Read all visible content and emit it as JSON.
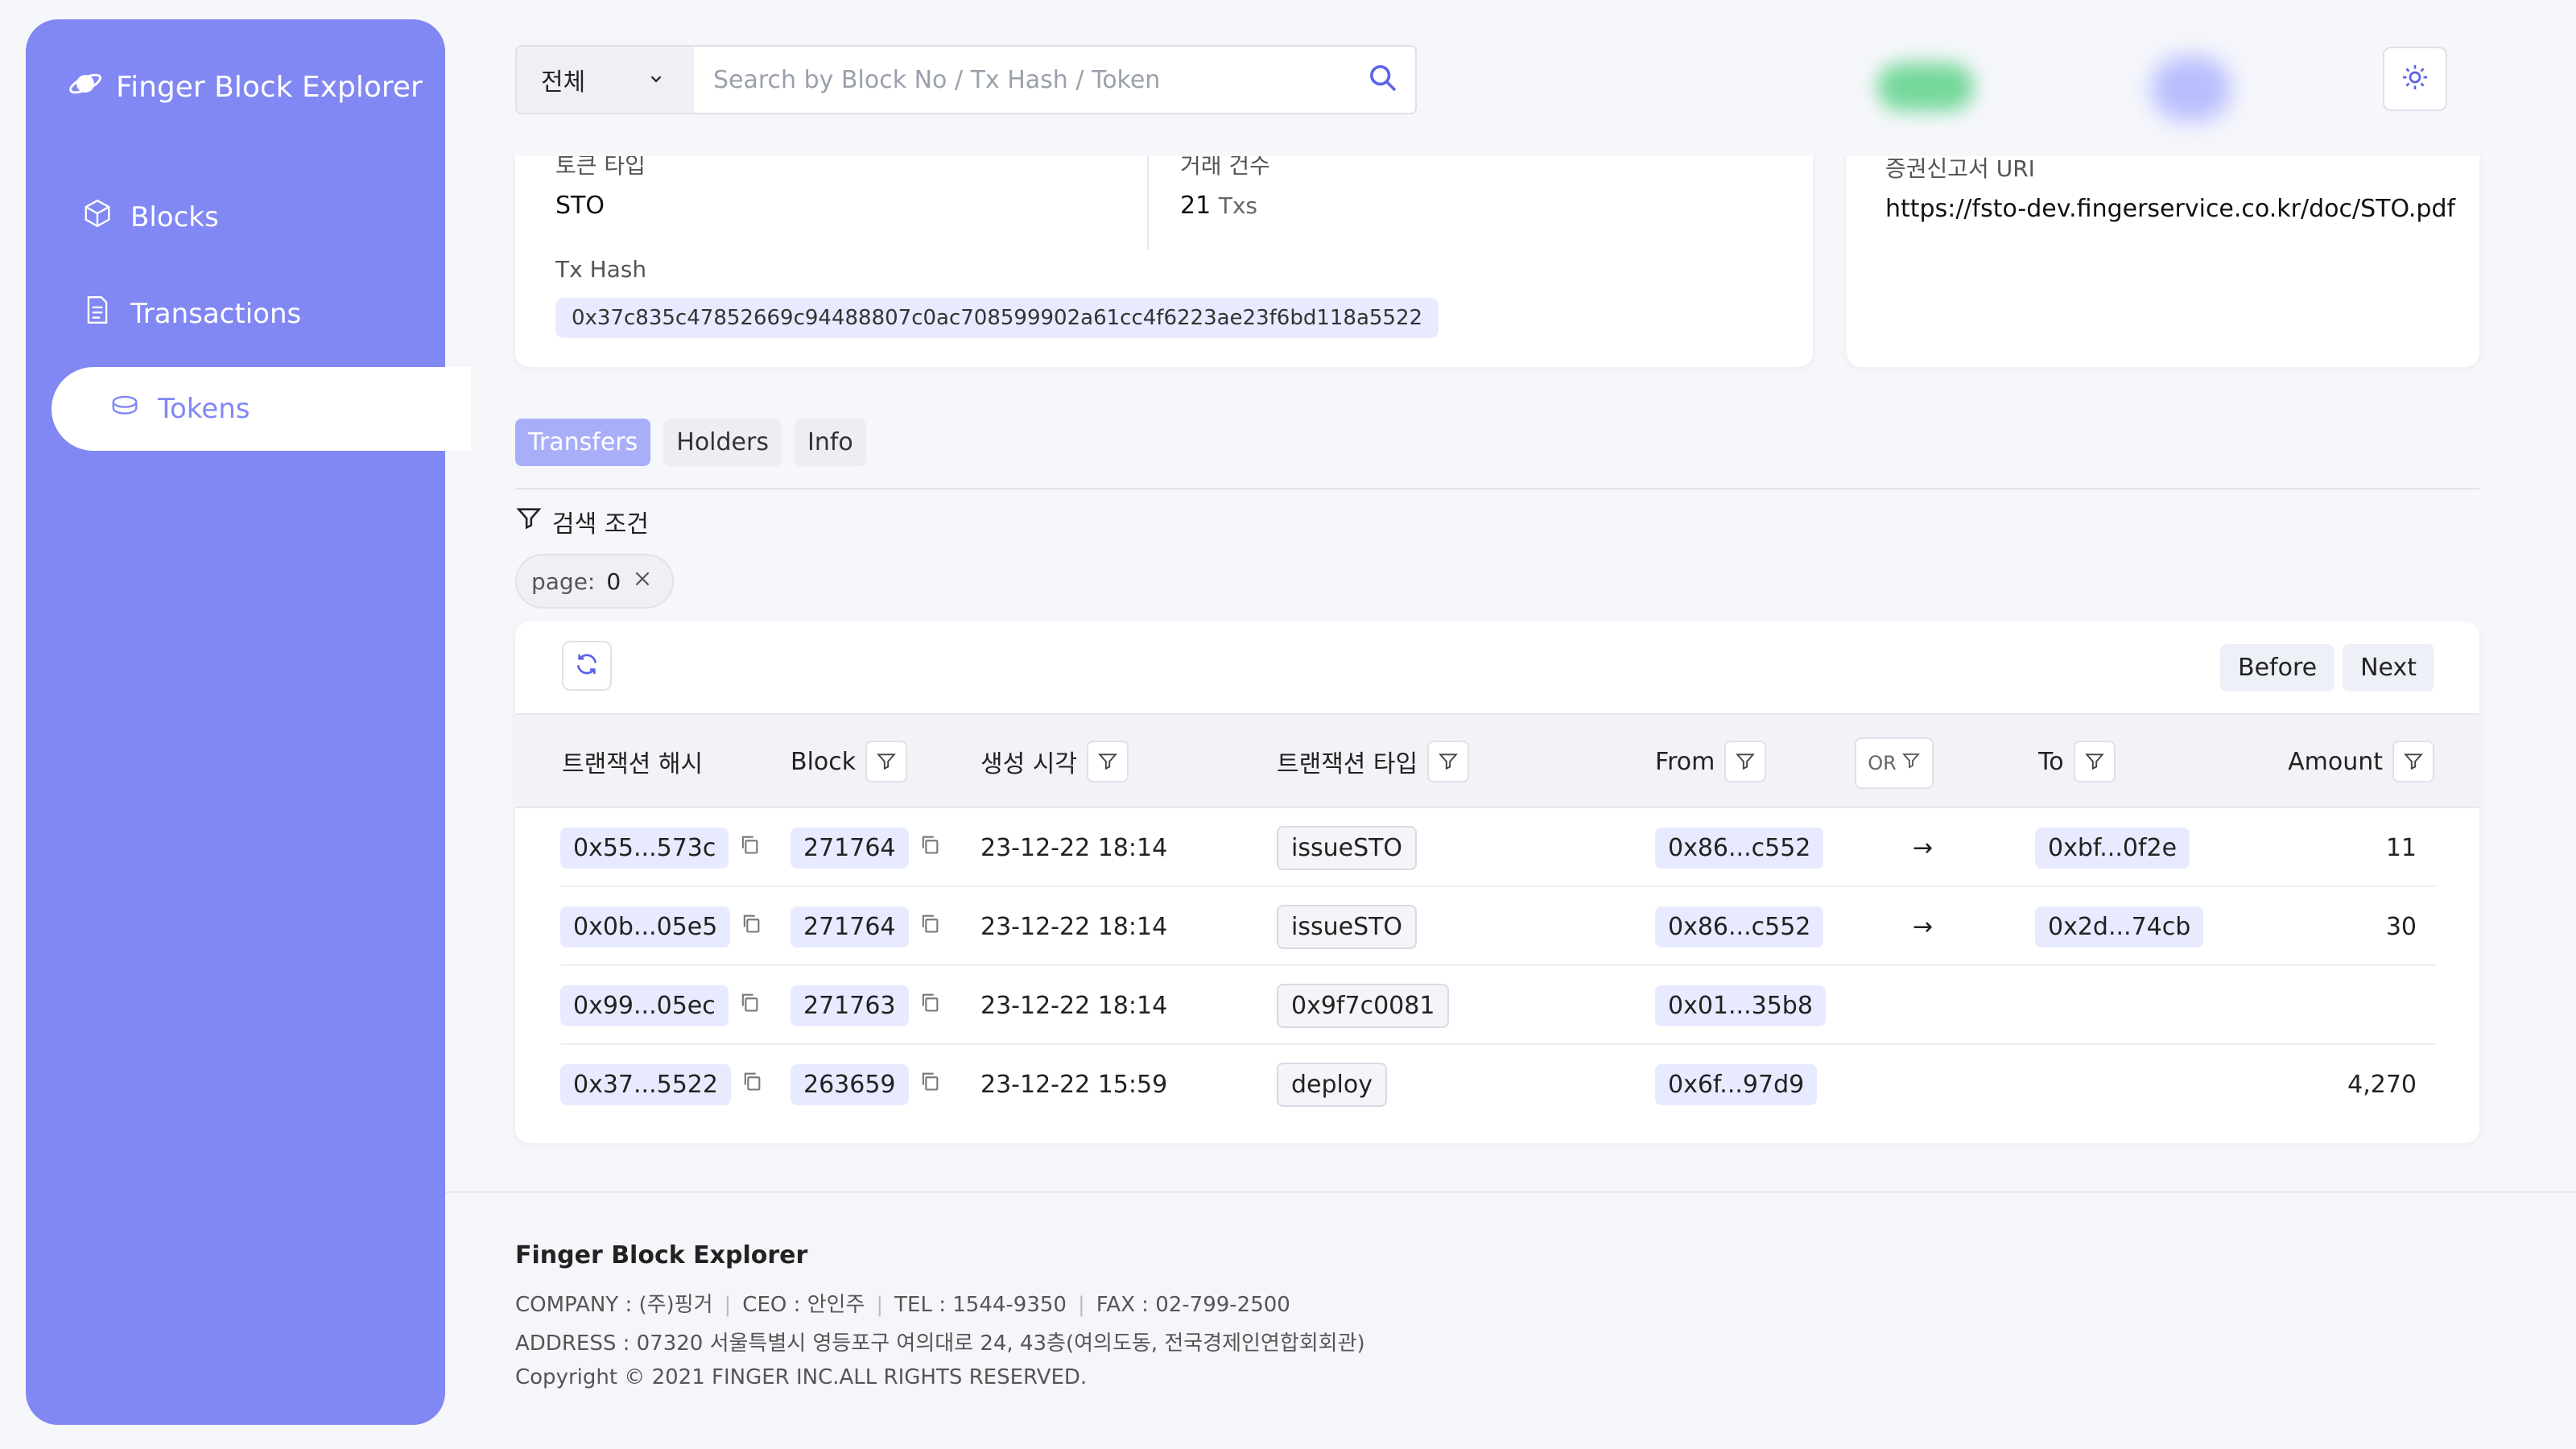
{
  "brand": {
    "name": "Finger Block Explorer"
  },
  "nav": [
    {
      "label": "Blocks",
      "icon": "cube-icon",
      "active": false
    },
    {
      "label": "Transactions",
      "icon": "document-icon",
      "active": false
    },
    {
      "label": "Tokens",
      "icon": "coin-icon",
      "active": true
    }
  ],
  "search": {
    "scope": "전체",
    "placeholder": "Search by Block No / Tx Hash / Token",
    "value": ""
  },
  "token_info": {
    "type_label": "토큰 타입",
    "type_value": "STO",
    "tx_count_label": "거래 건수",
    "tx_count_value": "21",
    "tx_count_unit": "Txs",
    "tx_hash_label": "Tx Hash",
    "tx_hash_value": "0x37c835c47852669c94488807c0ac708599902a61cc4f6223ae23f6bd118a5522",
    "uri_label": "증권신고서 URI",
    "uri_value": "https://fsto-dev.fingerservice.co.kr/doc/STO.pdf"
  },
  "tabs": [
    {
      "label": "Transfers",
      "active": true
    },
    {
      "label": "Holders",
      "active": false
    },
    {
      "label": "Info",
      "active": false
    }
  ],
  "filter": {
    "title": "검색 조건",
    "chip_key": "page:",
    "chip_value": "0"
  },
  "pager": {
    "before": "Before",
    "next": "Next"
  },
  "table": {
    "headers": {
      "hash": "트랜잭션 해시",
      "block": "Block",
      "time": "생성 시각",
      "type": "트랜잭션 타입",
      "from": "From",
      "or": "OR",
      "to": "To",
      "amount": "Amount"
    },
    "rows": [
      {
        "hash": "0x55...573c",
        "block": "271764",
        "time": "23-12-22 18:14",
        "type": "issueSTO",
        "from": "0x86...c552",
        "arrow": "→",
        "to": "0xbf...0f2e",
        "amount": "11"
      },
      {
        "hash": "0x0b...05e5",
        "block": "271764",
        "time": "23-12-22 18:14",
        "type": "issueSTO",
        "from": "0x86...c552",
        "arrow": "→",
        "to": "0x2d...74cb",
        "amount": "30"
      },
      {
        "hash": "0x99...05ec",
        "block": "271763",
        "time": "23-12-22 18:14",
        "type": "0x9f7c0081",
        "from": "0x01...35b8",
        "arrow": "",
        "to": "",
        "amount": ""
      },
      {
        "hash": "0x37...5522",
        "block": "263659",
        "time": "23-12-22 15:59",
        "type": "deploy",
        "from": "0x6f...97d9",
        "arrow": "",
        "to": "",
        "amount": "4,270"
      }
    ]
  },
  "footer": {
    "title": "Finger Block Explorer",
    "company": "COMPANY : (주)핑거",
    "ceo": "CEO : 안인주",
    "tel": "TEL : 1544-9350",
    "fax": "FAX : 02-799-2500",
    "address": "ADDRESS : 07320 서울특별시 영등포구 여의대로 24, 43층(여의도동, 전국경제인연합회회관)",
    "copyright": "Copyright © 2021 FINGER INC.ALL RIGHTS RESERVED."
  },
  "colors": {
    "accent": "#8188f3",
    "chip": "#e8ebff",
    "tab_active": "#a9aef8"
  }
}
